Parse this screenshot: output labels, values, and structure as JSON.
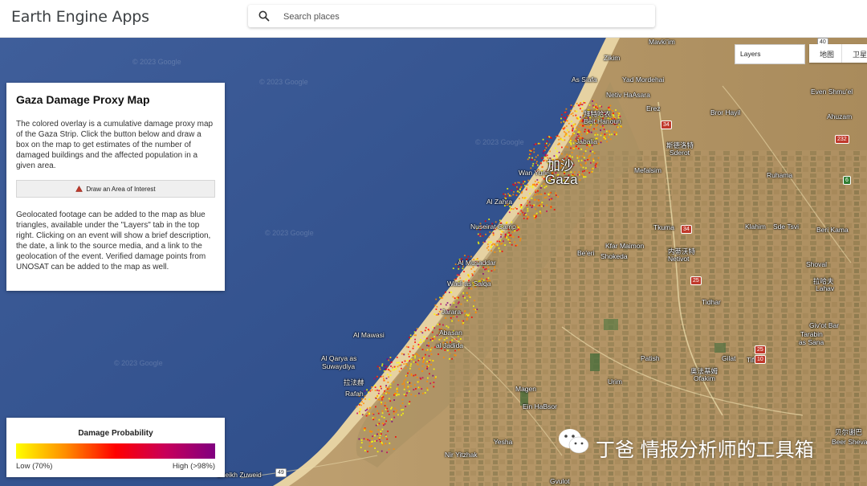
{
  "app": {
    "title": "Earth Engine Apps"
  },
  "search": {
    "placeholder": "Search places"
  },
  "map_controls": {
    "layers_label": "Layers",
    "map_type_buttons": [
      "地图",
      "卫星"
    ]
  },
  "panel": {
    "title": "Gaza Damage Proxy Map",
    "intro": "The colored overlay is a cumulative damage proxy map of the Gaza Strip. Click the button below and draw a box on the map to get estimates of the number of damaged buildings and the affected population in a given area.",
    "button_label": "Draw an Area of Interest",
    "geolocated": "Geolocated footage can be added to the map as blue triangles, available under the \"Layers\" tab in the top right. Clicking on an event will show a brief description, the date, a link to the source media, and a link to the geolocation of the event. Verified damage points from UNOSAT can be added to the map as well."
  },
  "legend": {
    "title": "Damage Probability",
    "low_label": "Low (70%)",
    "high_label": "High (>98%)",
    "colors": [
      "#ffff00",
      "#ff8c00",
      "#ff0000",
      "#c8005a",
      "#800080"
    ]
  },
  "watermark": "© 2023 Google",
  "map_labels": {
    "mavkiim": "Mavki'im",
    "zikim": "Zikim",
    "as_siafa": "As Siafa",
    "yad_mordehai": "Yad Mordehai",
    "netiv_haasara": "Netiv HaAsara",
    "beit_hanoun_cn": "拜特哈农",
    "beit_hanoun": "Beit Hanoun",
    "jabalia": "Jabalia",
    "gaza_cn": "加沙",
    "gaza": "Gaza",
    "al_zahra": "Al Zahra",
    "erez": "Erez",
    "sderot_cn": "斯德洛特",
    "sderot": "Sderot",
    "mefalsim": "Mefalsim",
    "bror_hayil": "Bror Hayil",
    "even_shmuel": "Even Shmu'el",
    "ahuzam": "Ahuzam",
    "ruhama": "Ruhama",
    "nuseirat_camp": "Nuseirat Camp",
    "al_musaddar": "Al Musaddar",
    "wadi_as_salqa": "Wadi as Salqa",
    "kfar_maimon": "Kfar Maimon",
    "beeri": "Be'eri",
    "shokeda": "Shokeda",
    "netivot_cn": "内蒂沃特",
    "netivot": "Netivot",
    "tkuma": "Tkuma",
    "klahim": "Klahim",
    "sde_tzvi": "Sde Tsvi",
    "beri_kama": "Beri Kama",
    "shoval": "Shoval",
    "lahav_cn": "拉哈夫",
    "lahav": "Lahav",
    "tidhar": "Tidhar",
    "givot_bar": "Giv'ot Bar",
    "tarabin": "Tarabin",
    "as_sana": "as Sana",
    "jarara": "Jarara",
    "abasan": "Abasan",
    "al_jadida": "al Jadida",
    "al_mawasi": "Al Mawasi",
    "al_qarya": "Al Qarya as",
    "suwaydiya": "Suwaydiya",
    "patish": "Patish",
    "gilat": "Gilat",
    "tifrah": "Tifrah",
    "ofakim_cn": "奥法基姆",
    "ofakim": "Ofakim",
    "urim": "Urim",
    "rafah_cn": "拉法赫",
    "rafah": "Rafah",
    "magen": "Magen",
    "ein_habsor": "Ein HaBsor",
    "yesha": "Yesha",
    "nir_yitzhak": "Nir Yitzhak",
    "sheikh_zuweid": "Sheikh Zuweid",
    "gvulot": "Gvulot",
    "beersheba_cn": "贝尔谢巴",
    "beersheba": "Beer Sheva",
    "wan_yunis": "Wan Yunis"
  },
  "road_shields": {
    "r34a": "34",
    "r232": "232",
    "r34b": "34",
    "r25a": "25",
    "r25b": "25",
    "r6": "6",
    "r40": "40",
    "r49": "49",
    "r10": "10"
  },
  "wechat": {
    "text": "丁爸 情报分析师的工具箱"
  }
}
